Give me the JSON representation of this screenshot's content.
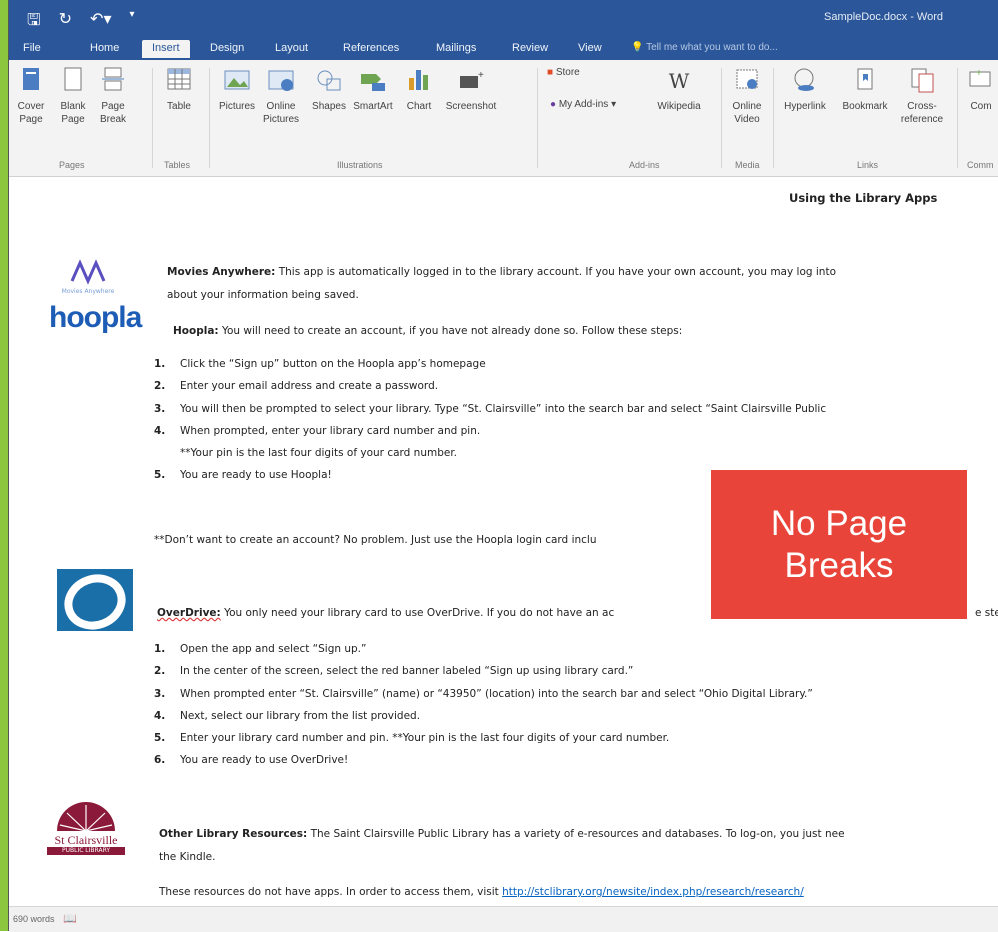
{
  "app": {
    "title": "SampleDoc.docx - Word"
  },
  "tabs": [
    {
      "label": "File"
    },
    {
      "label": "Home"
    },
    {
      "label": "Insert"
    },
    {
      "label": "Design"
    },
    {
      "label": "Layout"
    },
    {
      "label": "References"
    },
    {
      "label": "Mailings"
    },
    {
      "label": "Review"
    },
    {
      "label": "View"
    }
  ],
  "tell_me": "Tell me what you want to do...",
  "ribbon": {
    "pages": {
      "label": "Pages",
      "buttons": [
        "Cover\nPage",
        "Blank\nPage",
        "Page\nBreak"
      ]
    },
    "tables": {
      "label": "Tables",
      "buttons": [
        "Table"
      ]
    },
    "illustrations": {
      "label": "Illustrations",
      "buttons": [
        "Pictures",
        "Online\nPictures",
        "Shapes",
        "SmartArt",
        "Chart",
        "Screenshot"
      ]
    },
    "addins": {
      "label": "Add-ins",
      "store": "Store",
      "myaddins": "My Add-ins",
      "wikipedia": "Wikipedia"
    },
    "media": {
      "label": "Media",
      "buttons": [
        "Online\nVideo"
      ]
    },
    "links": {
      "label": "Links",
      "buttons": [
        "Hyperlink",
        "Bookmark",
        "Cross-\nreference"
      ]
    },
    "comments": {
      "label": "Comm",
      "buttons": [
        "Com"
      ]
    }
  },
  "document": {
    "heading": "Using the Library Apps",
    "movies": {
      "name": "Movies Anywhere:",
      "line1": " This app is automatically logged in to the library account. If you have your own account, you may log into",
      "line2": "about your information being saved."
    },
    "hoopla": {
      "name": "Hoopla:",
      "intro": " You will need to create an account, if you have not already done so. Follow these steps:",
      "steps": [
        "Click the “Sign up” button on the Hoopla app’s homepage",
        "Enter your email address and create a password.",
        "You will then be prompted to select your library. Type “St. Clairsville” into the search bar and select “Saint Clairsville Public",
        "When prompted, enter your library card number and pin.",
        "You are ready to use Hoopla!"
      ],
      "pin_note": "**Your pin is the last four digits of your card number.",
      "no_account": "**Don’t want to create an account? No problem. Just use the Hoopla login card inclu"
    },
    "overdrive": {
      "name": "OverDrive:",
      "intro": " You only need your library card to use OverDrive. If you do not have an ac",
      "intro_tail": "e ste",
      "steps": [
        "Open the app and select “Sign up.”",
        "In the center of the screen, select the red banner labeled “Sign up using library card.”",
        "When prompted enter “St. Clairsville” (name) or “43950” (location) into the search bar and select “Ohio Digital Library.”",
        "Next, select our library from the list provided.",
        "Enter your library card number and pin. **Your pin is the last four digits of your card number.",
        "You are ready to use OverDrive!"
      ]
    },
    "other": {
      "name": "Other Library Resources:",
      "line1": " The Saint Clairsville Public Library has a variety of e-resources and databases. To log-on, you just nee",
      "line2": "the Kindle.",
      "visit": "These resources do not have apps. In order to access them, visit ",
      "url": "http://stclibrary.org/newsite/index.php/research/research/"
    },
    "logos": {
      "hoopla": "hoopla",
      "movies_caption": "Movies Anywhere",
      "stc_line1": "St Clairsville",
      "stc_line2": "PUBLIC LIBRARY"
    }
  },
  "status": {
    "words": "690 words"
  },
  "banner": {
    "line1": "No Page",
    "line2": "Breaks",
    "color": "#e8443a"
  },
  "colors": {
    "word_blue": "#2b579a",
    "green": "#8cc63f"
  }
}
